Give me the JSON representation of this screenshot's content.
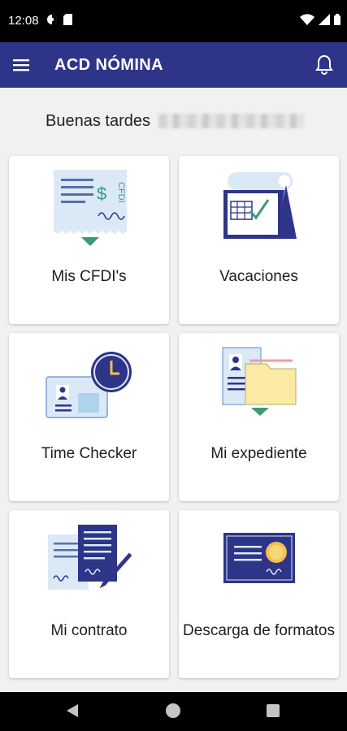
{
  "status_bar": {
    "time": "12:08"
  },
  "app_bar": {
    "title": "ACD NÓMINA",
    "menu_icon": "menu-icon",
    "notification_icon": "bell-icon"
  },
  "greeting": {
    "text": "Buenas tardes"
  },
  "colors": {
    "primary": "#2e3488",
    "illustration_light": "#dbe9f7",
    "accent_green": "#3a9b74",
    "folder_yellow": "#fbeaa3"
  },
  "cards": [
    {
      "label": "Mis CFDI's",
      "icon": "cfdi-receipt-icon",
      "illus_text": "$ CFDI"
    },
    {
      "label": "Vacaciones",
      "icon": "calendar-check-icon"
    },
    {
      "label": "Time Checker",
      "icon": "id-card-clock-icon"
    },
    {
      "label": "Mi expediente",
      "icon": "folder-file-icon"
    },
    {
      "label": "Mi contrato",
      "icon": "contract-pen-icon"
    },
    {
      "label": "Descarga de formatos",
      "icon": "certificate-icon"
    }
  ],
  "nav_bar": {
    "back_icon": "back-icon",
    "home_icon": "home-icon",
    "recents_icon": "recents-icon"
  }
}
